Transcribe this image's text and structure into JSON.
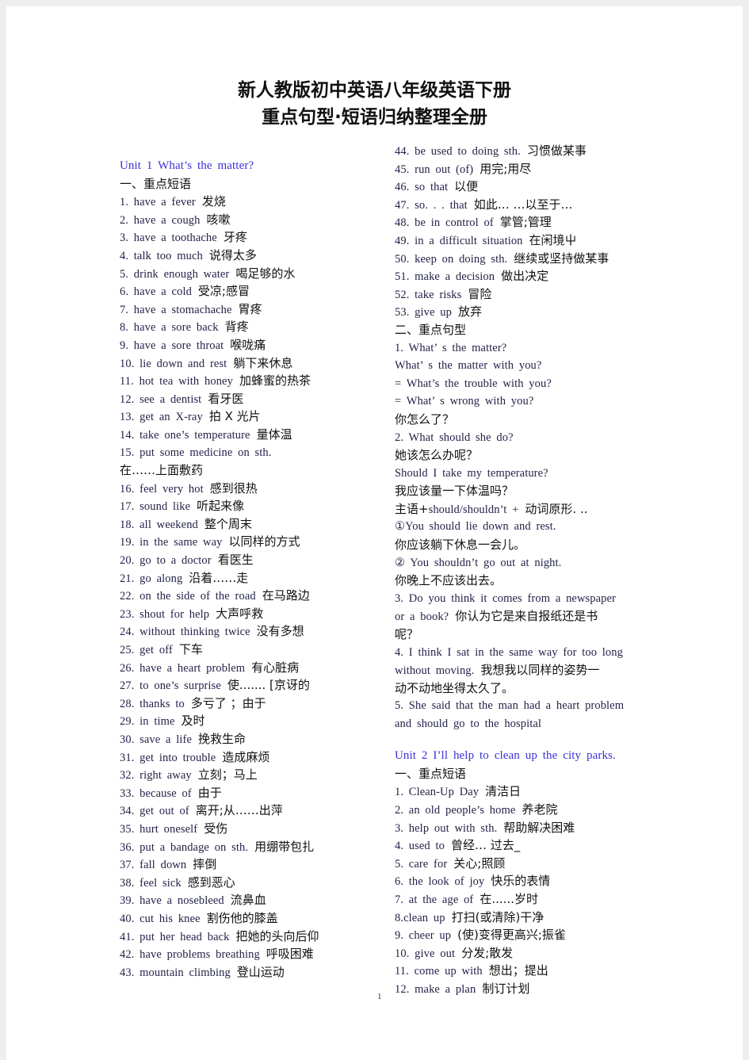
{
  "title": {
    "line1": "新人教版初中英语八年级英语下册",
    "line2": "重点句型·短语归纳整理全册"
  },
  "colors": {
    "unit_heading": "#3a2fd6",
    "english_text": "#23234a",
    "chinese_text": "#111111"
  },
  "left_column": [
    {
      "en": "Unit 1 What’s the matter?",
      "zh": "",
      "type": "unit"
    },
    {
      "en": "",
      "zh": "一、重点短语"
    },
    {
      "en": "1. have a fever",
      "zh": "发烧"
    },
    {
      "en": "2. have a cough",
      "zh": "咳嗽"
    },
    {
      "en": "3. have a toothache",
      "zh": "牙疼"
    },
    {
      "en": "4. talk too much",
      "zh": "说得太多"
    },
    {
      "en": "5. drink enough water",
      "zh": "喝足够的水"
    },
    {
      "en": "6. have a cold",
      "zh": "受凉;感冒"
    },
    {
      "en": "7. have a stomachache",
      "zh": "胃疼"
    },
    {
      "en": "8. have a sore back",
      "zh": "背疼"
    },
    {
      "en": "9. have a sore throat",
      "zh": "喉咙痛"
    },
    {
      "en": "10. lie down and rest",
      "zh": "躺下来休息"
    },
    {
      "en": "11. hot tea with honey",
      "zh": "加蜂蜜的热茶"
    },
    {
      "en": "12. see a dentist",
      "zh": "看牙医"
    },
    {
      "en": "13. get an X-ray",
      "zh": "拍 X 光片"
    },
    {
      "en": "14. take one’s temperature",
      "zh": "量体温"
    },
    {
      "en": "15. put some medicine on sth.",
      "zh": ""
    },
    {
      "en": "",
      "zh": "在……上面敷药"
    },
    {
      "en": "16. feel very hot",
      "zh": "感到很热"
    },
    {
      "en": "17. sound like",
      "zh": "听起来像"
    },
    {
      "en": "18. all weekend",
      "zh": "整个周末"
    },
    {
      "en": "19. in the same way",
      "zh": "以同样的方式"
    },
    {
      "en": "20. go to a doctor",
      "zh": "看医生"
    },
    {
      "en": "21. go along",
      "zh": "沿着……走"
    },
    {
      "en": "22. on the side of the road",
      "zh": "在马路边"
    },
    {
      "en": "23. shout for help",
      "zh": "大声呼救"
    },
    {
      "en": "24. without thinking twice",
      "zh": "没有多想"
    },
    {
      "en": "25. get off",
      "zh": "下车"
    },
    {
      "en": "26. have a heart problem",
      "zh": "有心脏病"
    },
    {
      "en": "27. to one’s surprise",
      "zh": "使....... [京讶的"
    },
    {
      "en": "28. thanks to",
      "zh": "多亏了 ；由于"
    },
    {
      "en": "29. in time",
      "zh": "及时"
    },
    {
      "en": "30. save a life",
      "zh": "挽救生命"
    },
    {
      "en": "31. get into trouble",
      "zh": "造成麻烦"
    },
    {
      "en": "32. right away",
      "zh": "立刻；马上"
    },
    {
      "en": "33. because of",
      "zh": "由于"
    },
    {
      "en": "34. get out of",
      "zh": "离开;从……出萍"
    },
    {
      "en": "35. hurt oneself",
      "zh": "受伤"
    },
    {
      "en": "36. put a bandage on sth.",
      "zh": "用绷带包扎"
    },
    {
      "en": "37. fall down",
      "zh": "摔倒"
    },
    {
      "en": "38. feel sick",
      "zh": "感到恶心"
    },
    {
      "en": "39. have a nosebleed",
      "zh": "流鼻血"
    },
    {
      "en": "40. cut his knee",
      "zh": "割伤他的膝盖"
    },
    {
      "en": "41. put her head back",
      "zh": "把她的头向后仰"
    },
    {
      "en": "42. have problems breathing",
      "zh": "呼吸困难"
    },
    {
      "en": "43. mountain climbing",
      "zh": "登山运动"
    }
  ],
  "right_column": [
    {
      "en": "44. be used to doing sth.",
      "zh": "习惯做某事"
    },
    {
      "en": "45. run out (of)",
      "zh": "用完;用尽"
    },
    {
      "en": "46. so that",
      "zh": "以便"
    },
    {
      "en": "47. so. . . that",
      "zh": "如此… …以至于…"
    },
    {
      "en": "48. be in control of",
      "zh": "掌管;管理"
    },
    {
      "en": "49. in a difficult situation",
      "zh": "在闲境屮"
    },
    {
      "en": "50. keep on doing sth.",
      "zh": "继续或坚持做某事"
    },
    {
      "en": "51. make a decision",
      "zh": "做出决定"
    },
    {
      "en": "52. take risks",
      "zh": "冒险"
    },
    {
      "en": "53. give up",
      "zh": "放弃"
    },
    {
      "en": "",
      "zh": "二、重点句型"
    },
    {
      "en": "1. What’ s the matter?",
      "zh": ""
    },
    {
      "en": "What’ s the matter with you?",
      "zh": ""
    },
    {
      "en": "= What’s the trouble with you?",
      "zh": ""
    },
    {
      "en": "= What’ s wrong with you?",
      "zh": ""
    },
    {
      "en": "",
      "zh": "你怎么了？"
    },
    {
      "en": "2. What should she do?",
      "zh": ""
    },
    {
      "en": "",
      "zh": "她该怎么办呢？"
    },
    {
      "en": "Should I take my temperature?",
      "zh": ""
    },
    {
      "en": "",
      "zh": "我应该量一下体温吗？"
    },
    {
      "en": "",
      "zh": "主语+",
      "en2": "should/shouldn’t +",
      "zh2": "动词原形. .."
    },
    {
      "en": "①You should lie down and rest.",
      "zh": ""
    },
    {
      "en": "",
      "zh": "你应该躺下休息一会儿。"
    },
    {
      "en": "② You shouldn’t go out at night.",
      "zh": ""
    },
    {
      "en": "",
      "zh": "你晚上不应该出去。"
    },
    {
      "en": "3. Do you think it comes from a newspaper",
      "zh": ""
    },
    {
      "en": "or a book?",
      "zh": "你认为它是来自报纸还是书"
    },
    {
      "en": "",
      "zh": "呢？"
    },
    {
      "en": "4. I think I sat in the same way for too long",
      "zh": ""
    },
    {
      "en": "without moving.",
      "zh": "我想我以同样的姿势一"
    },
    {
      "en": "",
      "zh": "动不动地坐得太久了。"
    },
    {
      "en": "5. She said that the man had a heart problem",
      "zh": ""
    },
    {
      "en": "and should go to the hospital",
      "zh": ""
    },
    {
      "en": "",
      "zh": "",
      "type": "gap"
    },
    {
      "en": "Unit 2 I’ll help to clean up the city parks.",
      "zh": "",
      "type": "unit"
    },
    {
      "en": "",
      "zh": "一、重点短语"
    },
    {
      "en": "1. Clean-Up Day",
      "zh": "清洁日"
    },
    {
      "en": "2. an old people’s home",
      "zh": "养老院"
    },
    {
      "en": "3. help out with sth.",
      "zh": "帮助解决困难"
    },
    {
      "en": "4. used to",
      "zh": "曾经… 过去_"
    },
    {
      "en": "5. care for",
      "zh": "关心;照顾"
    },
    {
      "en": "6. the look of joy",
      "zh": "快乐的表情"
    },
    {
      "en": "7. at the age of",
      "zh": "在......岁时"
    },
    {
      "en": "8.clean up",
      "zh": "打扫(或清除)干净"
    },
    {
      "en": "9. cheer up",
      "zh": "(使)变得更高兴;振雀"
    },
    {
      "en": "10. give out",
      "zh": "分发;散发"
    },
    {
      "en": "11. come up with",
      "zh": "想出；提出"
    },
    {
      "en": "12. make a plan",
      "zh": "制订计划"
    }
  ],
  "page_number": "1"
}
